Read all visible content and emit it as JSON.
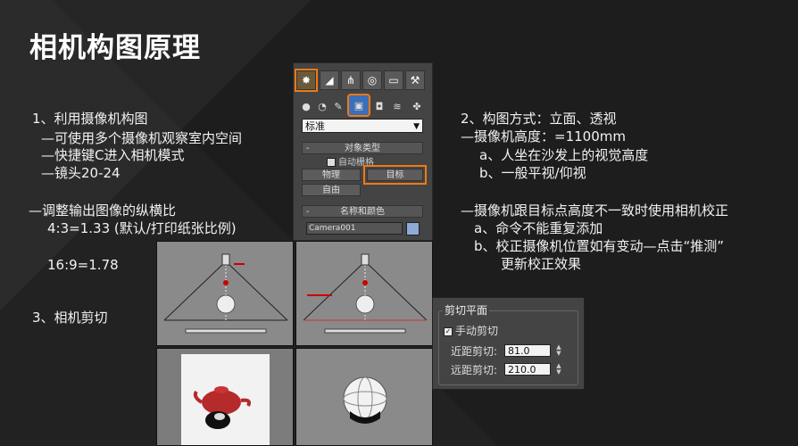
{
  "title": "相机构图原理",
  "left_text": {
    "l1": "1、利用摄像机构图",
    "l2": "—可使用多个摄像机观察室内空间",
    "l3": "—快捷键C进入相机模式",
    "l4": "—镜头20-24",
    "l5": "—调整输出图像的纵横比",
    "l6": "4:3=1.33 (默认/打印纸张比例)",
    "l7": "16:9=1.78",
    "l8": "3、相机剪切"
  },
  "right_text": {
    "r1": "2、构图方式：立面、透视",
    "r2": "—摄像机高度：=1100mm",
    "r3": "a、人坐在沙发上的视觉高度",
    "r4": "b、一般平视/仰视",
    "r5": "—摄像机跟目标点高度不一致时使用相机校正",
    "r6": "a、命令不能重复添加",
    "r7": "b、校正摄像机位置如有变动—点击“推测”",
    "r8": "更新校正效果"
  },
  "create_panel": {
    "dropdown_value": "标准",
    "object_type_label": "对象类型",
    "auto_grid_label": "自动栅格",
    "buttons": {
      "physical": "物理",
      "target": "目标",
      "free": "自由"
    },
    "name_color_label": "名称和颜色",
    "camera_name": "Camera001",
    "swatch_color": "#8faad8",
    "highlight_color": "#f07a16"
  },
  "clipping": {
    "title": "剪切平面",
    "manual_label": "手动剪切",
    "manual_checked": true,
    "near_label": "近距剪切:",
    "near_value": "81.0",
    "far_label": "远距剪切:",
    "far_value": "210.0"
  }
}
